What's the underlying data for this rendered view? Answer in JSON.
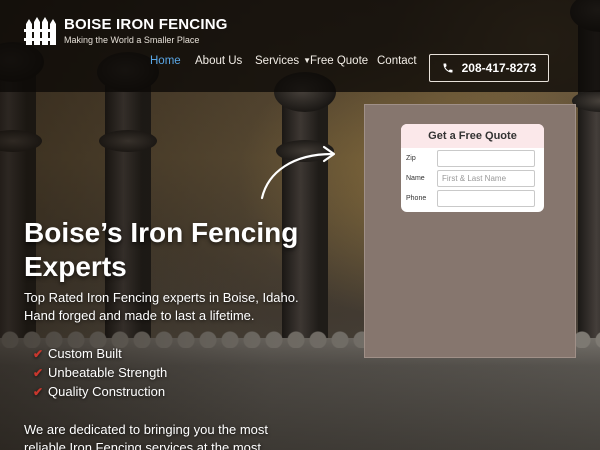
{
  "header": {
    "brand_name": "BOISE IRON FENCING",
    "tagline": "Making the World a Smaller Place",
    "phone": "208-417-8273"
  },
  "nav": {
    "items": [
      {
        "label": "Home",
        "active": true
      },
      {
        "label": "About Us"
      },
      {
        "label": "Services",
        "has_dropdown": true
      },
      {
        "label": "Free Quote"
      },
      {
        "label": "Contact"
      }
    ]
  },
  "hero": {
    "title": "Boise’s Iron Fencing Experts",
    "subtitle": "Top Rated Iron Fencing experts in Boise, Idaho. Hand forged and made to last a lifetime.",
    "features": [
      "Custom Built",
      "Unbeatable Strength",
      "Quality Construction"
    ],
    "body": "We are dedicated to bringing you the most reliable Iron Fencing services at the most"
  },
  "quote_form": {
    "title": "Get a Free Quote",
    "fields": [
      {
        "label": "Zip",
        "placeholder": "",
        "value": ""
      },
      {
        "label": "Name",
        "placeholder": "First & Last Name",
        "value": ""
      },
      {
        "label": "Phone",
        "placeholder": "",
        "value": ""
      }
    ]
  },
  "colors": {
    "accent_nav_active": "#5aa7e6",
    "check_red": "#c8372d",
    "quote_panel": "#86766e",
    "quote_header": "#fbe8ea"
  },
  "icons": [
    "fence-logo-icon",
    "phone-icon",
    "chevron-down-icon",
    "check-icon",
    "curved-arrow-icon"
  ]
}
